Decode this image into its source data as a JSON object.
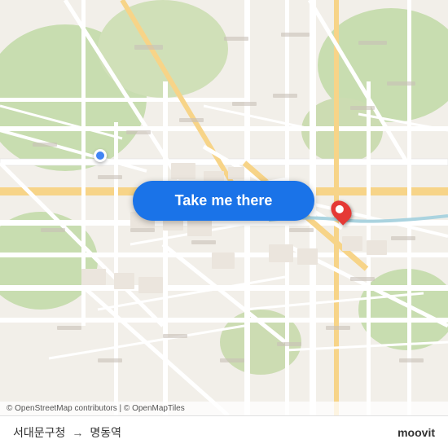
{
  "map": {
    "background_color": "#f2efe9",
    "origin_location": "서대문구청",
    "destination_location": "명동역",
    "attribution": "© OpenStreetMap contributors | © OpenMapTiles"
  },
  "button": {
    "label": "Take me there"
  },
  "bottom_bar": {
    "from_label": "서대문구청",
    "arrow": "→",
    "to_label": "명동역",
    "app_name": "moovit"
  }
}
